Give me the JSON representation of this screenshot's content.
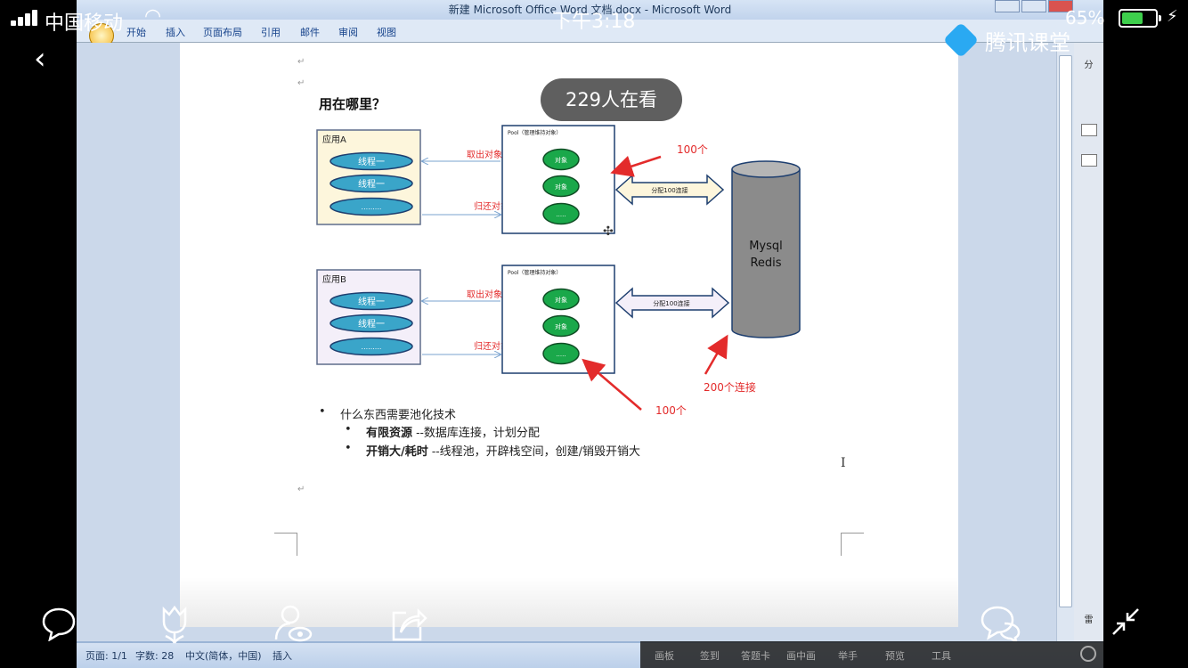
{
  "phone_status": {
    "carrier": "中国移动",
    "time": "下午3:18",
    "battery": "65%",
    "battery_level": 0.65
  },
  "brand": "腾讯课堂",
  "viewers": "229人在看",
  "word": {
    "title": "新建 Microsoft Office Word 文档.docx - Microsoft Word",
    "tabs": [
      "开始",
      "插入",
      "页面布局",
      "引用",
      "邮件",
      "审阅",
      "视图"
    ],
    "statusbar": {
      "page": "页面: 1/1",
      "words": "字数: 28",
      "language": "中文(简体，中国)",
      "mode": "插入"
    },
    "right_panel": [
      "分",
      "雷"
    ]
  },
  "document": {
    "para_mark": "↵",
    "heading": "用在哪里？",
    "bullets": [
      {
        "text": "什么东西需要池化技术",
        "level": 1
      },
      {
        "bold": "有限资源",
        "rest": " --数据库连接，计划分配",
        "level": 2
      },
      {
        "bold": "开销大/耗时",
        "rest": " --线程池，开辟栈空间，创建/销毁开销大",
        "level": 2
      }
    ]
  },
  "diagram": {
    "app_a": {
      "title": "应用A",
      "threads": [
        "线程一",
        "线程一",
        "........."
      ]
    },
    "app_b": {
      "title": "应用B",
      "threads": [
        "线程一",
        "线程一",
        "........."
      ]
    },
    "pool_label": "Pool（管理维持对象）",
    "pool_items": [
      "对象",
      "对象",
      "....."
    ],
    "take": "取出对象",
    "return": "归还对象",
    "alloc": "分配100连接",
    "db": [
      "Mysql",
      "Redis"
    ],
    "ann_100_top": "100个",
    "ann_100_bottom": "100个",
    "ann_200": "200个连接"
  },
  "bottom_toolbar": [
    "画板",
    "签到",
    "答题卡",
    "画中画",
    "举手",
    "预览",
    "工具"
  ],
  "colors": {
    "accent_red": "#e32b2b",
    "pool_green": "#1aa84a",
    "thread_blue": "#3aa5c9",
    "db_gray": "#8b8b8b"
  }
}
